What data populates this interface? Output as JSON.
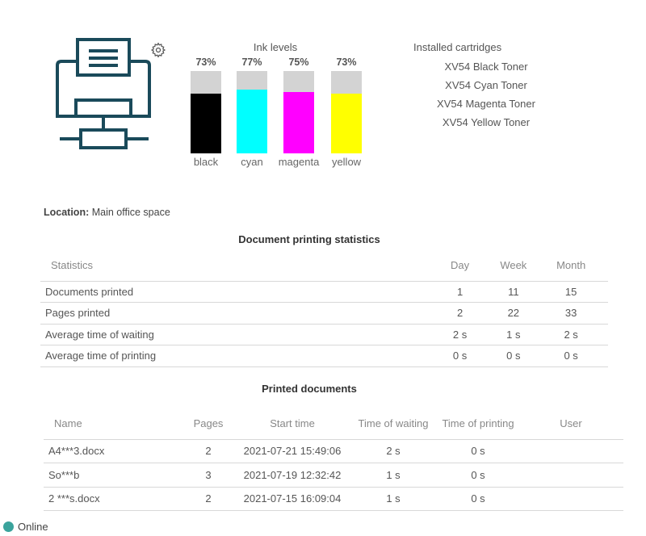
{
  "colors": {
    "printer_icon": "#1a4a5a",
    "status_online": "#3aa39c"
  },
  "ink": {
    "title": "Ink levels",
    "bars": [
      {
        "label": "black",
        "percent_text": "73%",
        "level": 0.73,
        "color": "#000000"
      },
      {
        "label": "cyan",
        "percent_text": "77%",
        "level": 0.77,
        "color": "#00ffff"
      },
      {
        "label": "magenta",
        "percent_text": "75%",
        "level": 0.75,
        "color": "#ff00ff"
      },
      {
        "label": "yellow",
        "percent_text": "73%",
        "level": 0.73,
        "color": "#ffff00"
      }
    ]
  },
  "cartridges": {
    "title": "Installed cartridges",
    "items": [
      "XV54 Black Toner",
      "XV54 Cyan Toner",
      "XV54 Magenta Toner",
      "XV54 Yellow Toner"
    ]
  },
  "location": {
    "label": "Location:",
    "value": "Main office space"
  },
  "stats": {
    "title": "Document printing statistics",
    "headers": [
      "Statistics",
      "Day",
      "Week",
      "Month"
    ],
    "rows": [
      [
        "Documents printed",
        "1",
        "11",
        "15"
      ],
      [
        "Pages printed",
        "2",
        "22",
        "33"
      ],
      [
        "Average time of waiting",
        "2 s",
        "1 s",
        "2 s"
      ],
      [
        "Average time of printing",
        "0 s",
        "0 s",
        "0 s"
      ]
    ]
  },
  "documents": {
    "title": "Printed documents",
    "headers": [
      "Name",
      "Pages",
      "Start time",
      "Time of waiting",
      "Time of printing",
      "User"
    ],
    "rows": [
      [
        "A4***3.docx",
        "2",
        "2021-07-21 15:49:06",
        "2 s",
        "0 s",
        ""
      ],
      [
        "So***b",
        "3",
        "2021-07-19 12:32:42",
        "1 s",
        "0 s",
        ""
      ],
      [
        "2 ***s.docx",
        "2",
        "2021-07-15 16:09:04",
        "1 s",
        "0 s",
        ""
      ]
    ]
  },
  "status": {
    "text": "Online"
  },
  "icons": {
    "printer": "printer-icon",
    "settings": "gear-icon",
    "status": "status-dot-icon"
  }
}
